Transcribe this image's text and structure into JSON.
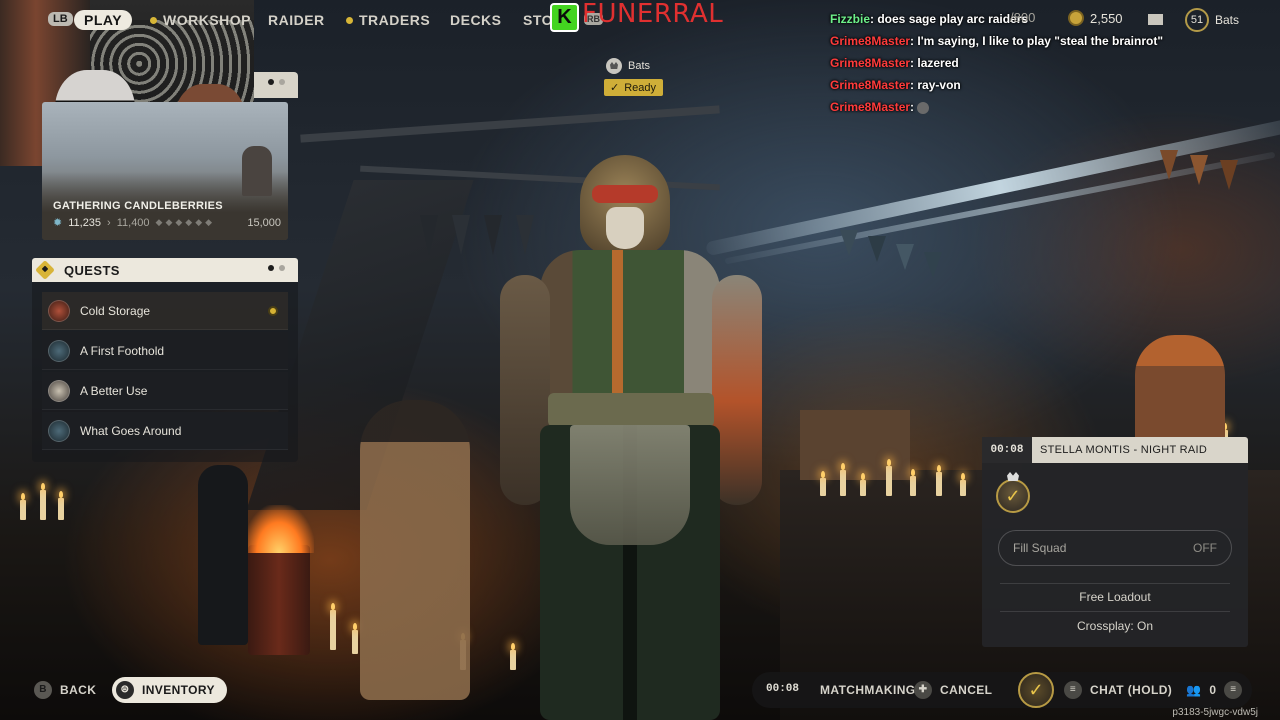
{
  "topnav": {
    "lb": "LB",
    "play": "PLAY",
    "workshop": "WORKSHOP",
    "raider": "RAIDER",
    "traders": "TRADERS",
    "decks": "DECKS",
    "store": "STO",
    "rb": "RB"
  },
  "stream": {
    "channel_name": "FUNERRAL",
    "logo_letter": "K"
  },
  "chat": [
    {
      "user": "Fizzbie",
      "message": ": does sage play arc raiders",
      "color": "green"
    },
    {
      "user": "Grime8Master",
      "message": ": I'm saying, I like to play \"steal the brainrot\"",
      "color": "red"
    },
    {
      "user": "Grime8Master",
      "message": ": lazered",
      "color": "red"
    },
    {
      "user": "Grime8Master",
      "message": ": ray-von",
      "color": "red"
    },
    {
      "user": "Grime8Master",
      "message": ": ",
      "color": "red"
    }
  ],
  "currency": {
    "partial": "/800",
    "coins": "2,550",
    "level": "51",
    "player_name": "Bats"
  },
  "lobby": {
    "player_name": "Bats",
    "ready_label": "Ready"
  },
  "event": {
    "title": "GATHERING CANDLEBERRIES",
    "current": "11,235",
    "next": "11,400",
    "goal": "15,000",
    "progress_fraction": 0.749
  },
  "quests": {
    "title": "QUESTS",
    "items": [
      {
        "label": "Cold Storage",
        "tracked": true
      },
      {
        "label": "A First Foothold",
        "tracked": false
      },
      {
        "label": "A Better Use",
        "tracked": false
      },
      {
        "label": "What Goes Around",
        "tracked": false
      }
    ]
  },
  "squad": {
    "timer": "00:08",
    "map_title": "STELLA MONTIS - NIGHT RAID",
    "fill_squad_label": "Fill Squad",
    "fill_squad_state": "OFF",
    "loadout": "Free Loadout",
    "crossplay": "Crossplay: On"
  },
  "bottom": {
    "back_glyph": "B",
    "back_label": "BACK",
    "inventory_label": "INVENTORY",
    "mm_timer": "00:08",
    "matchmaking_label": "MATCHMAKING",
    "cancel_label": "CANCEL",
    "chat_label": "CHAT (HOLD)",
    "party_count": "0",
    "session_id": "p3183-5jwgc-vdw5j"
  },
  "colors": {
    "accent_gold": "#d7b637",
    "chat_user_red": "#ff3b3b",
    "chat_user_green": "#6df08a",
    "kick_green": "#43d420",
    "stream_red": "#e03030"
  }
}
